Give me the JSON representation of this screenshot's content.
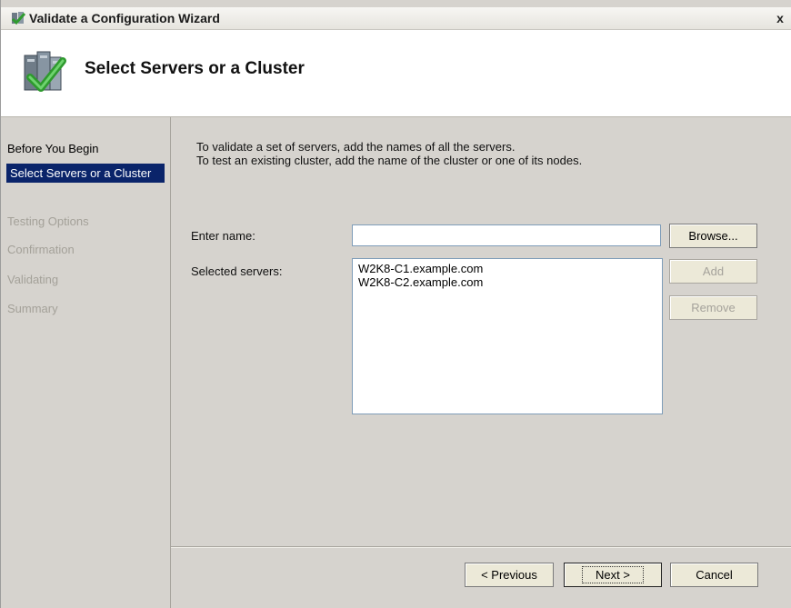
{
  "window": {
    "title": "Validate a Configuration Wizard",
    "close_label": "x"
  },
  "header": {
    "title": "Select Servers or a Cluster",
    "icon": "wizard-check-icon"
  },
  "sidebar": {
    "items": [
      {
        "label": "Before You Begin",
        "state": "normal"
      },
      {
        "label": "Select Servers or a Cluster",
        "state": "selected"
      },
      {
        "label": "Testing Options",
        "state": "disabled"
      },
      {
        "label": "Confirmation",
        "state": "disabled"
      },
      {
        "label": "Validating",
        "state": "disabled"
      },
      {
        "label": "Summary",
        "state": "disabled"
      }
    ]
  },
  "main": {
    "intro_line1": "To validate a set of servers, add the names of all the servers.",
    "intro_line2": "To test an existing cluster, add the name of the cluster or one of its nodes.",
    "enter_name_label": "Enter name:",
    "enter_name_value": "",
    "selected_servers_label": "Selected servers:",
    "servers": [
      "W2K8-C1.example.com",
      "W2K8-C2.example.com"
    ],
    "browse_label": "Browse...",
    "add_label": "Add",
    "remove_label": "Remove"
  },
  "footer": {
    "previous_label": "< Previous",
    "next_label": "Next >",
    "cancel_label": "Cancel"
  },
  "colors": {
    "selection": "#0a246a",
    "window_bg": "#d6d3ce",
    "disabled_text": "#a4a199"
  }
}
